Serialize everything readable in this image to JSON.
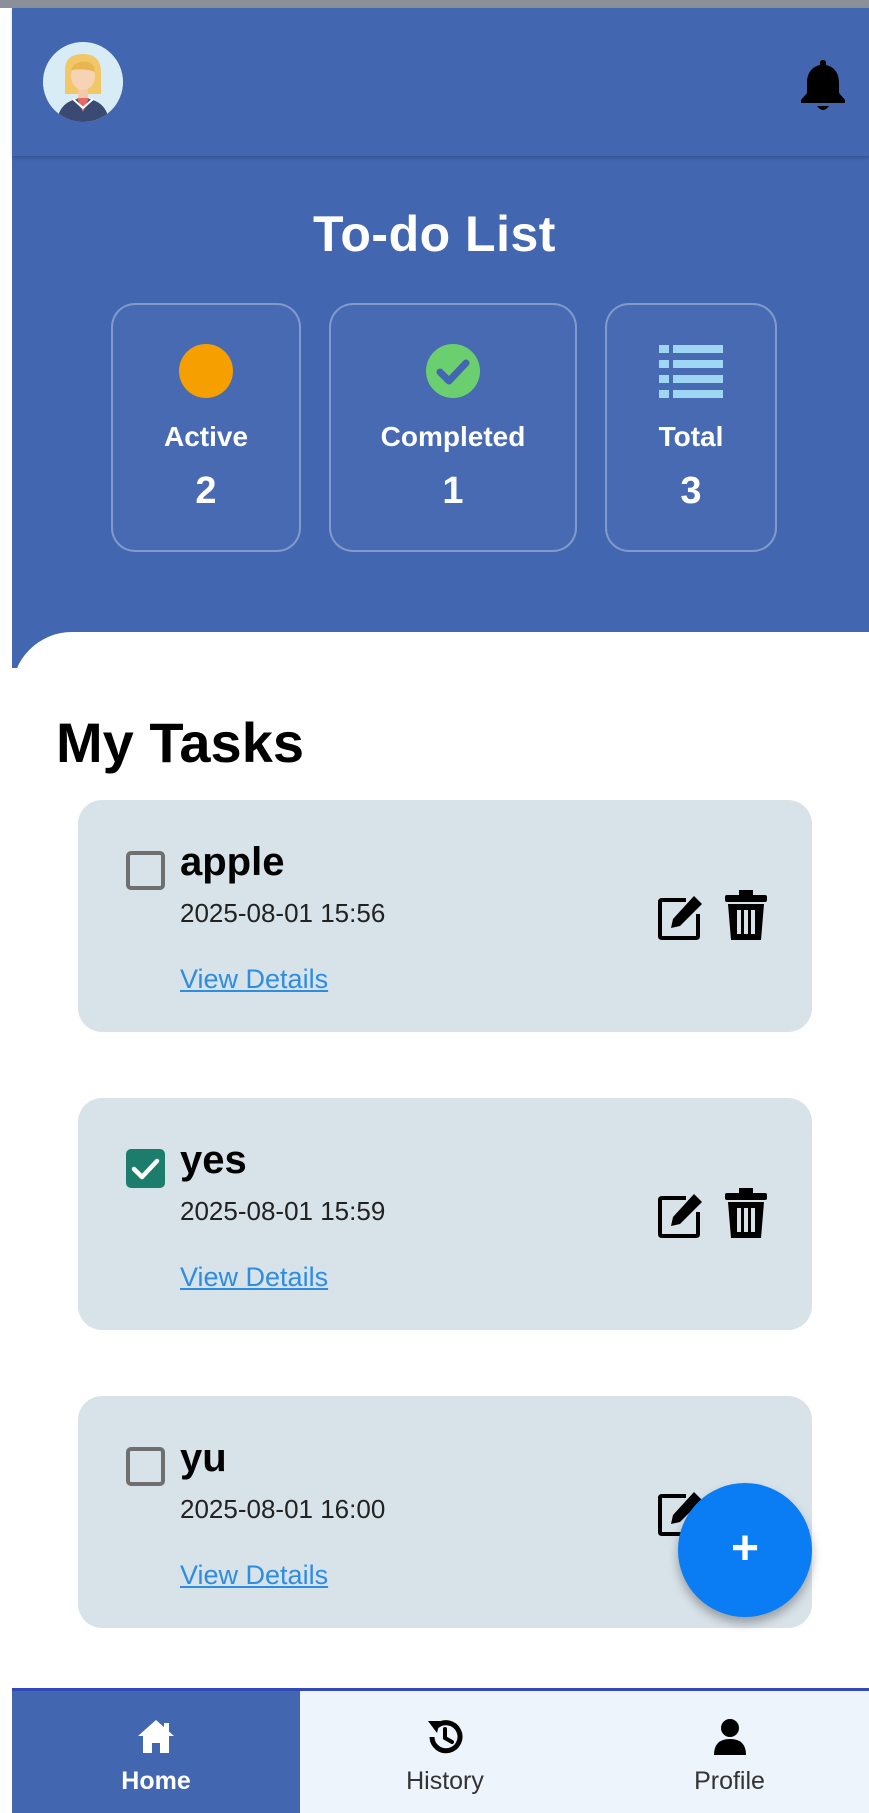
{
  "header": {
    "avatar_icon": "user-avatar-woman",
    "notification_icon": "bell-icon"
  },
  "hero": {
    "title": "To-do List",
    "stats": [
      {
        "label": "Active",
        "value": "2",
        "icon": "orange-circle-icon",
        "color": "#f5a000"
      },
      {
        "label": "Completed",
        "value": "1",
        "icon": "check-circle-icon",
        "color": "#6ccf6f"
      },
      {
        "label": "Total",
        "value": "3",
        "icon": "list-icon",
        "color": "#9fd6f4"
      }
    ]
  },
  "tasks_section": {
    "title": "My Tasks",
    "tasks": [
      {
        "title": "apple",
        "date": "2025-08-01 15:56",
        "link": "View Details",
        "completed": false
      },
      {
        "title": "yes",
        "date": "2025-08-01 15:59",
        "link": "View Details",
        "completed": true
      },
      {
        "title": "yu",
        "date": "2025-08-01 16:00",
        "link": "View Details",
        "completed": false
      }
    ]
  },
  "fab": {
    "label": "+",
    "icon": "plus-icon",
    "color": "#0a7cf4"
  },
  "bottom_nav": {
    "items": [
      {
        "label": "Home",
        "icon": "home-icon",
        "active": true
      },
      {
        "label": "History",
        "icon": "history-icon",
        "active": false
      },
      {
        "label": "Profile",
        "icon": "user-icon",
        "active": false
      }
    ]
  },
  "colors": {
    "primary": "#4266b0",
    "card_bg": "#d8e2e9",
    "link": "#2d8de0",
    "checkbox_checked": "#1d7d6c"
  }
}
